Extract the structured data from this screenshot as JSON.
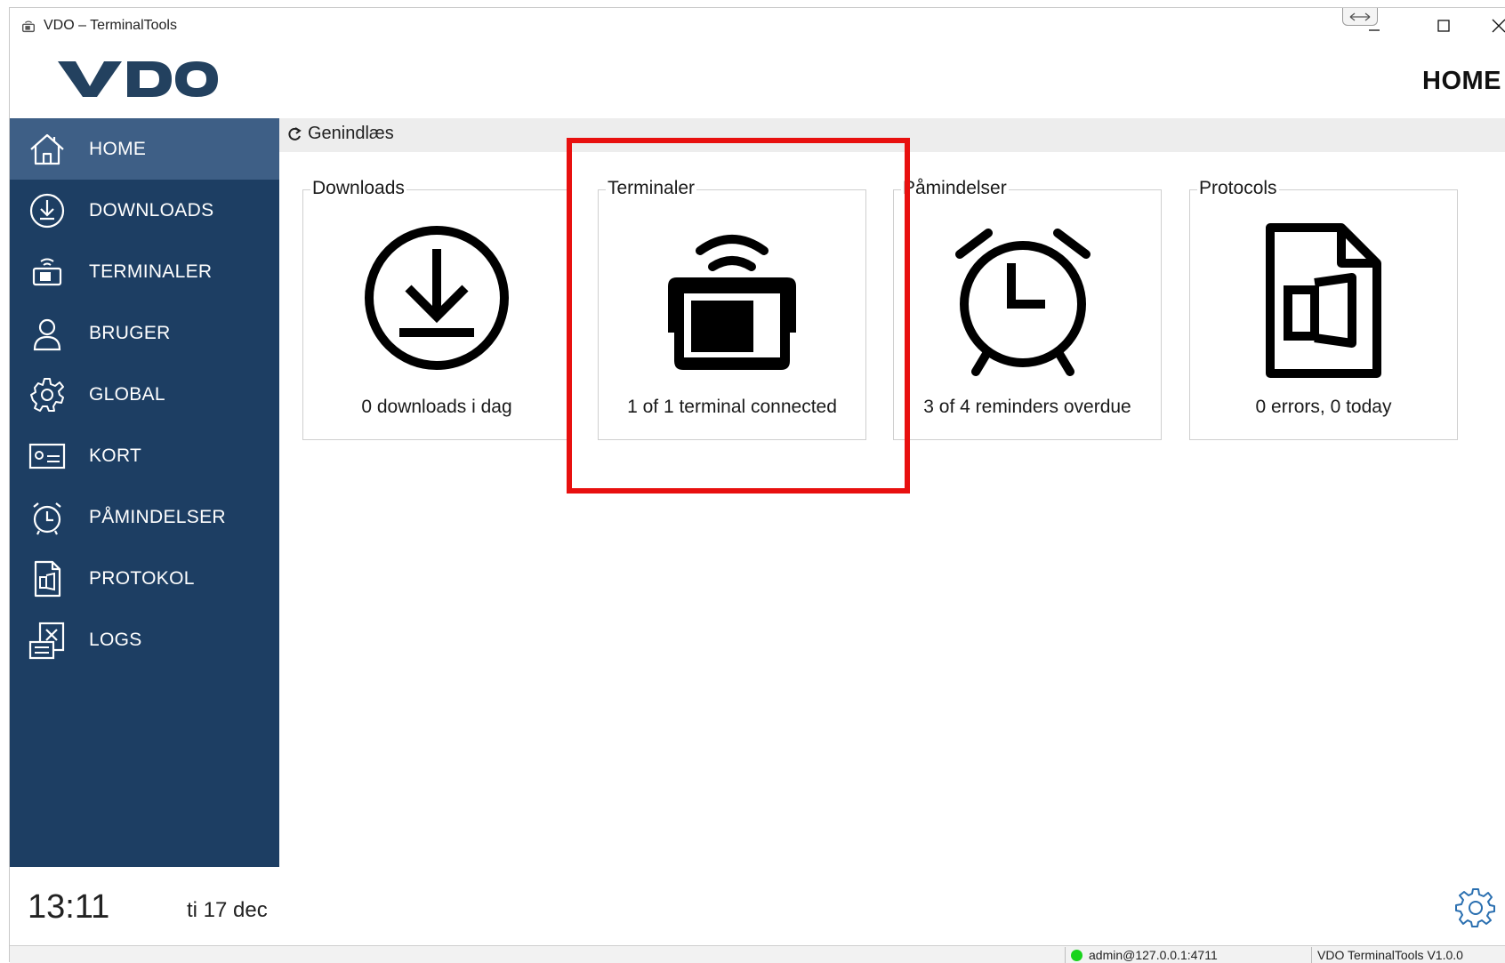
{
  "window": {
    "title": "VDO – TerminalTools",
    "min_symbol": "—",
    "max_symbol": "☐",
    "close_symbol": "✕"
  },
  "header": {
    "logo_text": "VDO",
    "page_title": "HOME"
  },
  "sidebar": {
    "items": [
      {
        "label": "HOME",
        "icon": "home-icon",
        "active": true
      },
      {
        "label": "DOWNLOADS",
        "icon": "download-icon",
        "active": false
      },
      {
        "label": "TERMINALER",
        "icon": "terminal-icon",
        "active": false
      },
      {
        "label": "BRUGER",
        "icon": "user-icon",
        "active": false
      },
      {
        "label": "GLOBAL",
        "icon": "gear-icon",
        "active": false
      },
      {
        "label": "KORT",
        "icon": "card-icon",
        "active": false
      },
      {
        "label": "PÅMINDELSER",
        "icon": "alarm-clock-icon",
        "active": false
      },
      {
        "label": "PROTOKOL",
        "icon": "document-icon",
        "active": false
      },
      {
        "label": "LOGS",
        "icon": "logs-icon",
        "active": false
      }
    ],
    "active_bg": "#3e5f86",
    "bg": "#1d3e63"
  },
  "clock": {
    "time": "13:11",
    "date": "ti 17 dec"
  },
  "toolbar": {
    "reload_label": "Genindlæs"
  },
  "cards": [
    {
      "title": "Downloads",
      "status": "0 downloads i dag",
      "icon": "download-icon"
    },
    {
      "title": "Terminaler",
      "status": "1 of 1 terminal connected",
      "icon": "terminal-icon"
    },
    {
      "title": "Påmindelser",
      "status": "3 of 4 reminders overdue",
      "icon": "alarm-clock-icon"
    },
    {
      "title": "Protocols",
      "status": "0 errors, 0 today",
      "icon": "document-icon"
    }
  ],
  "highlight_color": "#e8100f",
  "statusbar": {
    "connection": "admin@127.0.0.1:4711",
    "connection_status_color": "#19d31c",
    "version": "VDO TerminalTools V1.0.0"
  }
}
